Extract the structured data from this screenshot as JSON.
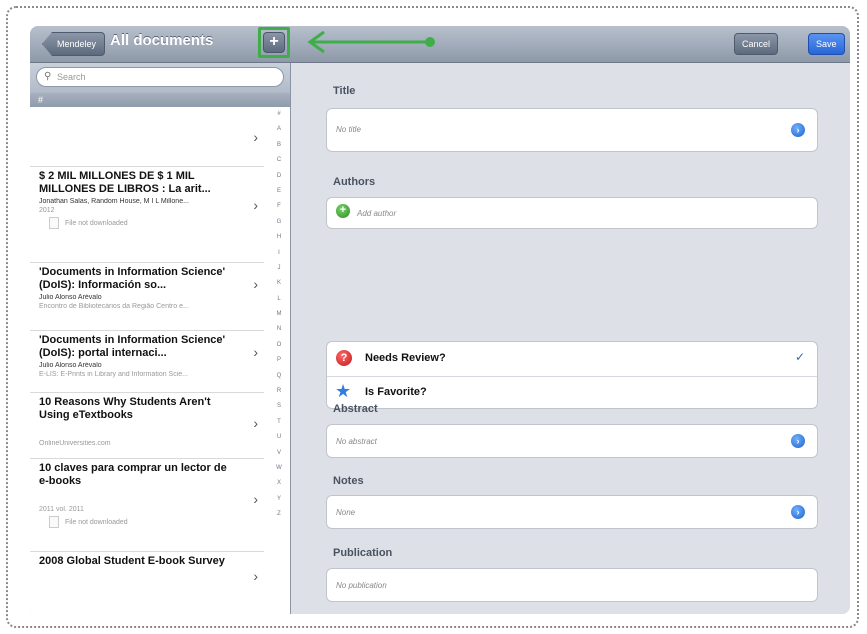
{
  "toolbar": {
    "back_label": "Mendeley",
    "title": "All documents",
    "add_label": "+",
    "cancel_label": "Cancel",
    "save_label": "Save"
  },
  "search": {
    "placeholder": "Search"
  },
  "list": {
    "section_header": "#",
    "rows": [
      {
        "title": "",
        "authors": "",
        "meta": "",
        "status": ""
      },
      {
        "title": "$ 2 MIL MILLONES DE $ 1 MIL MILLONES DE LIBROS : La arit...",
        "authors": "Jonathan Salas, Random House, M I L Millone...",
        "meta": "2012",
        "status": "File not downloaded"
      },
      {
        "title": "'Documents in Information Science' (DoIS): Información so...",
        "authors": "Julio Alonso Arévalo",
        "meta": "Encontro de Bibliotecários da Região Centro e...",
        "status": ""
      },
      {
        "title": "'Documents in Information Science' (DoIS): portal internaci...",
        "authors": "Julio Alonso Arévalo",
        "meta": "E-LIS: E-Prints in Library and Information Scie...",
        "status": ""
      },
      {
        "title": "10 Reasons Why Students Aren't Using eTextbooks",
        "authors": "",
        "meta": "OnlineUniversities.com",
        "status": ""
      },
      {
        "title": "10 claves para comprar un lector de e-books",
        "authors": "",
        "meta": "2011 vol. 2011",
        "status": "File not downloaded"
      },
      {
        "title": "2008 Global Student E-book Survey",
        "authors": "",
        "meta": "",
        "status": ""
      }
    ],
    "index_letters": [
      "#",
      "A",
      "B",
      "C",
      "D",
      "E",
      "F",
      "G",
      "H",
      "I",
      "J",
      "K",
      "L",
      "M",
      "N",
      "O",
      "P",
      "Q",
      "R",
      "S",
      "T",
      "U",
      "V",
      "W",
      "X",
      "Y",
      "Z"
    ]
  },
  "detail": {
    "title_label": "Title",
    "title_value": "No title",
    "authors_label": "Authors",
    "add_author": "Add author",
    "needs_review": "Needs Review?",
    "is_favorite": "Is Favorite?",
    "abstract_label": "Abstract",
    "abstract_value": "No abstract",
    "notes_label": "Notes",
    "notes_value": "None",
    "publication_label": "Publication",
    "publication_value": "No publication"
  },
  "colors": {
    "annotation": "#3fae49",
    "save": "#2766d8"
  }
}
